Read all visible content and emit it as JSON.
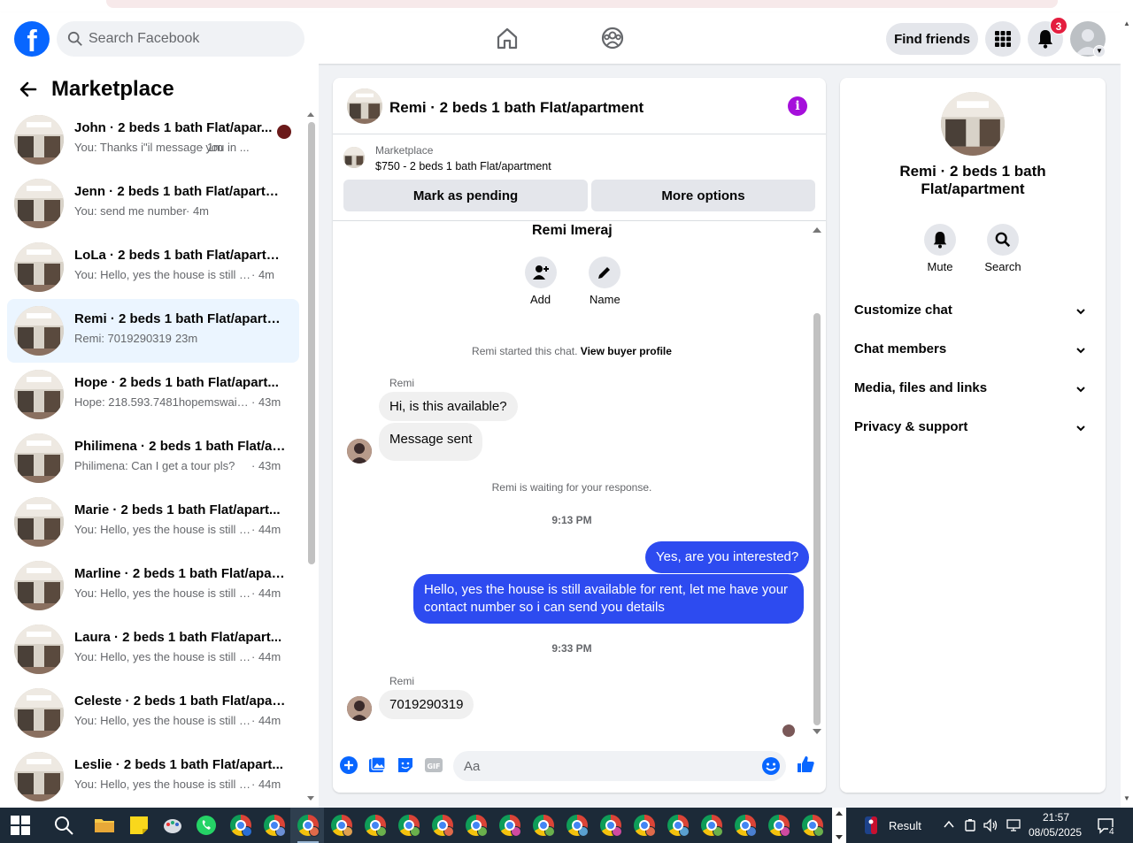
{
  "header": {
    "search_placeholder": "Search Facebook",
    "find_friends": "Find friends",
    "notification_count": "3"
  },
  "sidebar": {
    "title": "Marketplace",
    "conversations": [
      {
        "name": "John · 2 beds 1 bath Flat/apar...",
        "snippet": "You: Thanks i\"il message you in ...",
        "time": "· 1m"
      },
      {
        "name": "Jenn · 2 beds 1 bath Flat/apartm...",
        "snippet": "You: send me number",
        "time": "· 4m"
      },
      {
        "name": "LoLa · 2 beds 1 bath Flat/apartm...",
        "snippet": "You: Hello, yes the house is still av...",
        "time": "· 4m"
      },
      {
        "name": "Remi · 2 beds 1 bath Flat/apartm...",
        "snippet": "Remi: 7019290319",
        "time": "· 23m"
      },
      {
        "name": "Hope · 2 beds 1 bath Flat/apart...",
        "snippet": "Hope: 218.593.7481hopemswaisg...",
        "time": "· 43m"
      },
      {
        "name": "Philimena · 2 beds 1 bath Flat/ap...",
        "snippet": "Philimena: Can I get a tour pls?",
        "time": "· 43m"
      },
      {
        "name": "Marie · 2 beds 1 bath Flat/apart...",
        "snippet": "You: Hello, yes the house is still a...",
        "time": "· 44m"
      },
      {
        "name": "Marline · 2 beds 1 bath Flat/apar...",
        "snippet": "You: Hello, yes the house is still a...",
        "time": "· 44m"
      },
      {
        "name": "Laura · 2 beds 1 bath Flat/apart...",
        "snippet": "You: Hello, yes the house is still a...",
        "time": "· 44m"
      },
      {
        "name": "Celeste · 2 beds 1 bath Flat/apar...",
        "snippet": "You: Hello, yes the house is still a...",
        "time": "· 44m"
      },
      {
        "name": "Leslie · 2 beds 1 bath Flat/apart...",
        "snippet": "You: Hello, yes the house is still a...",
        "time": "· 44m"
      }
    ]
  },
  "chat": {
    "title": "Remi · 2 beds 1 bath Flat/apartment",
    "listing_category": "Marketplace",
    "listing_price": "$750 - 2 beds 1 bath Flat/apartment",
    "mark_pending": "Mark as pending",
    "more_options": "More options",
    "person_name": "Remi Imeraj",
    "add_label": "Add",
    "name_label": "Name",
    "started_text": "Remi started this chat.",
    "view_profile": "View buyer profile",
    "sender_name": "Remi",
    "msg1": "Hi, is this available?",
    "msg2": "Message sent",
    "waiting": "Remi is waiting for your response.",
    "time1": "9:13 PM",
    "out1": "Yes, are you interested?",
    "out2": "Hello, yes the house is still available for rent, let me have your contact number so i can send you details",
    "time2": "9:33 PM",
    "msg3": "7019290319",
    "composer_placeholder": "Aa"
  },
  "info_panel": {
    "title": "Remi · 2 beds 1 bath Flat/apartment",
    "mute": "Mute",
    "search": "Search",
    "sections": [
      "Customize chat",
      "Chat members",
      "Media, files and links",
      "Privacy & support"
    ]
  },
  "taskbar": {
    "result": "Result",
    "time": "21:57",
    "date": "08/05/2025",
    "notif_count": "4"
  },
  "colors": {
    "brand": "#0866ff",
    "outgoing_bubble": "#2d4bf0",
    "info_icon": "#a50fdb",
    "active_row": "#ebf5ff"
  }
}
